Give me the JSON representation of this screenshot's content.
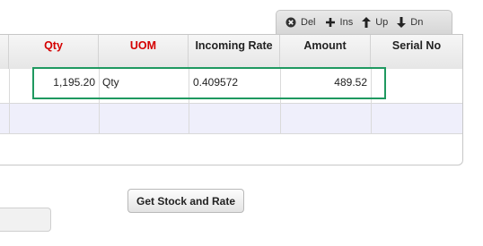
{
  "toolbar": {
    "del_label": "Del",
    "ins_label": "Ins",
    "up_label": "Up",
    "dn_label": "Dn"
  },
  "grid": {
    "columns": [
      "Qty",
      "UOM",
      "Incoming Rate",
      "Amount",
      "Serial No"
    ],
    "row": {
      "qty": "1,195.20",
      "uom": "Qty",
      "incoming_rate": "0.409572",
      "amount": "489.52",
      "serial_no": ""
    }
  },
  "actions": {
    "get_stock_label": "Get Stock and Rate"
  },
  "colors": {
    "mandatory_header": "#d40000",
    "selection_border": "#1f9960",
    "alt_row": "#efeffb"
  }
}
